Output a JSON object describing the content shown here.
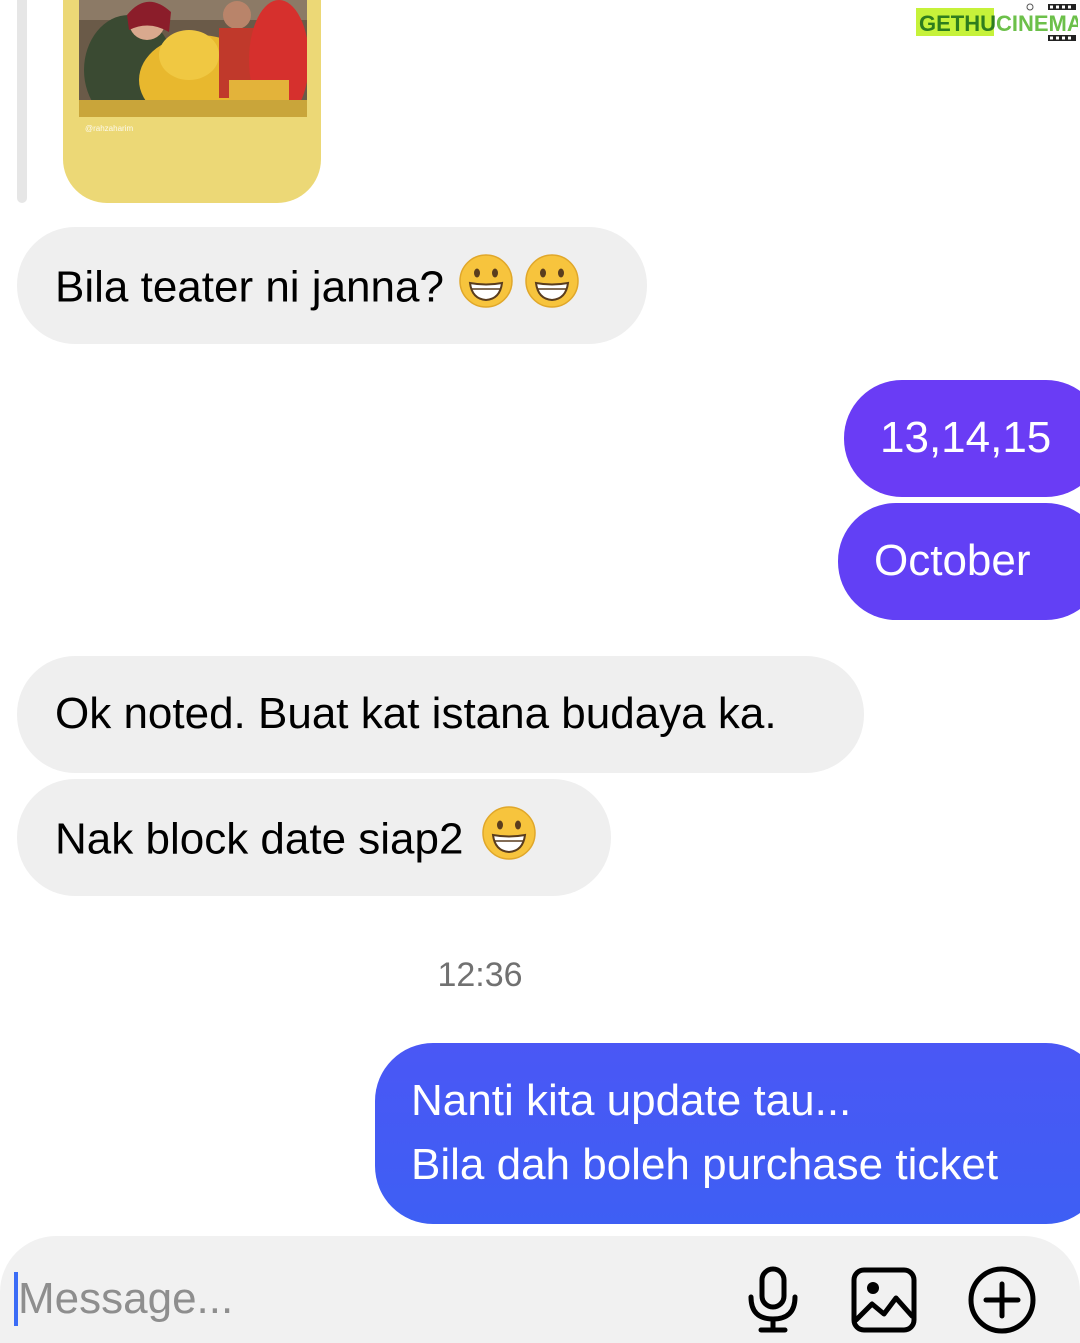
{
  "watermark": {
    "part1": "GETHU",
    "part2": "CINEMA",
    "color1": "#2e7d1e",
    "color2": "#6cc04a",
    "highlight": "#c6f23a"
  },
  "story": {
    "caption": "@rahzaharim",
    "background": "#ecd876"
  },
  "messages": [
    {
      "side": "received",
      "text": "Bila teater ni janna?",
      "emojis": [
        "grinning-face-emoji",
        "grinning-face-emoji"
      ]
    },
    {
      "side": "sent",
      "text": "13,14,15"
    },
    {
      "side": "sent",
      "text": "October"
    },
    {
      "side": "received",
      "text": "Ok noted. Buat kat istana budaya ka."
    },
    {
      "side": "received",
      "text": "Nak block date siap2",
      "emojis": [
        "grinning-face-emoji"
      ]
    },
    {
      "side": "sent",
      "lines": [
        "Nanti kita update tau...",
        "Bila dah boleh purchase ticket"
      ]
    }
  ],
  "timestamp": "12:36",
  "composer": {
    "placeholder": "Message...",
    "icons": [
      "microphone-icon",
      "gallery-icon",
      "add-icon"
    ]
  },
  "colors": {
    "sent_gradient_top": "#6b3cf5",
    "sent_gradient_bottom": "#3d5cf4",
    "received_bubble": "#efefef",
    "emoji_yellow": "#f7c43d"
  }
}
